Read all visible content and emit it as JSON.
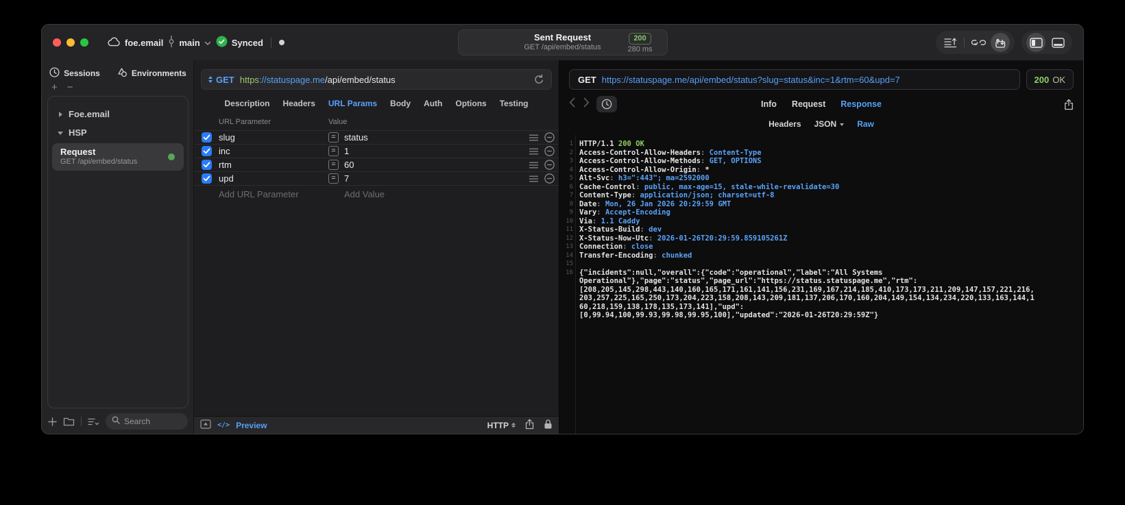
{
  "accent": "#58a0f8",
  "titlebar": {
    "project": "foe.email",
    "branch": "main",
    "sync_label": "Synced",
    "request_card": {
      "title": "Sent Request",
      "subtitle": "GET /api/embed/status",
      "status_code": "200",
      "duration": "280 ms"
    }
  },
  "sidebar": {
    "tabs": [
      {
        "label": "Sessions"
      },
      {
        "label": "Environments"
      }
    ],
    "add_label": "+",
    "remove_label": "−",
    "tree": [
      {
        "label": "Foe.email"
      },
      {
        "label": "HSP"
      }
    ],
    "request_item": {
      "title": "Request",
      "subtitle": "GET /api/embed/status"
    },
    "search_placeholder": "Search"
  },
  "request_panel": {
    "method": "GET",
    "url": {
      "scheme": "https",
      "host": "://statuspage.me",
      "path": "/api/embed/status"
    },
    "tabs": [
      "Description",
      "Headers",
      "URL Params",
      "Body",
      "Auth",
      "Options",
      "Testing"
    ],
    "active_tab": "URL Params",
    "params": {
      "col_name": "URL Parameter",
      "col_value": "Value",
      "rows": [
        {
          "name": "slug",
          "value": "status",
          "checked": true
        },
        {
          "name": "inc",
          "value": "1",
          "checked": true
        },
        {
          "name": "rtm",
          "value": "60",
          "checked": true
        },
        {
          "name": "upd",
          "value": "7",
          "checked": true
        }
      ],
      "add_name": "Add URL Parameter",
      "add_value": "Add Value"
    },
    "footer": {
      "code_glyph": "</>",
      "preview": "Preview",
      "protocol": "HTTP"
    }
  },
  "response_panel": {
    "method": "GET",
    "url": "https://statuspage.me/api/embed/status?slug=status&inc=1&rtm=60&upd=7",
    "status_code": "200",
    "status_text": "OK",
    "tabs": [
      "Info",
      "Request",
      "Response"
    ],
    "active_tab": "Response",
    "subtabs": [
      "Headers",
      "JSON",
      "Raw"
    ],
    "active_subtab": "Raw",
    "code_lines": [
      {
        "n": "1",
        "seg": [
          [
            "HTTP/1.1 ",
            "p"
          ],
          [
            "200 OK",
            "g"
          ]
        ]
      },
      {
        "n": "2",
        "seg": [
          [
            "Access-Control-Allow-Headers",
            "p"
          ],
          [
            ": ",
            "d"
          ],
          [
            "Content-Type",
            "b"
          ]
        ]
      },
      {
        "n": "3",
        "seg": [
          [
            "Access-Control-Allow-Methods",
            "p"
          ],
          [
            ": ",
            "d"
          ],
          [
            "GET, OPTIONS",
            "b"
          ]
        ]
      },
      {
        "n": "4",
        "seg": [
          [
            "Access-Control-Allow-Origin",
            "p"
          ],
          [
            ": ",
            "d"
          ],
          [
            "*",
            "p"
          ]
        ]
      },
      {
        "n": "5",
        "seg": [
          [
            "Alt-Svc",
            "p"
          ],
          [
            ": ",
            "d"
          ],
          [
            "h3=\":443\"; ma=2592000",
            "b"
          ]
        ]
      },
      {
        "n": "6",
        "seg": [
          [
            "Cache-Control",
            "p"
          ],
          [
            ": ",
            "d"
          ],
          [
            "public, max-age=15, stale-while-revalidate=30",
            "b"
          ]
        ]
      },
      {
        "n": "7",
        "seg": [
          [
            "Content-Type",
            "p"
          ],
          [
            ": ",
            "d"
          ],
          [
            "application/json; charset=utf-8",
            "b"
          ]
        ]
      },
      {
        "n": "8",
        "seg": [
          [
            "Date",
            "p"
          ],
          [
            ": ",
            "d"
          ],
          [
            "Mon, 26 Jan 2026 20:29:59 GMT",
            "b"
          ]
        ]
      },
      {
        "n": "9",
        "seg": [
          [
            "Vary",
            "p"
          ],
          [
            ": ",
            "d"
          ],
          [
            "Accept-Encoding",
            "b"
          ]
        ]
      },
      {
        "n": "10",
        "seg": [
          [
            "Via",
            "p"
          ],
          [
            ": ",
            "d"
          ],
          [
            "1.1 Caddy",
            "b"
          ]
        ]
      },
      {
        "n": "11",
        "seg": [
          [
            "X-Status-Build",
            "p"
          ],
          [
            ": ",
            "d"
          ],
          [
            "dev",
            "b"
          ]
        ]
      },
      {
        "n": "12",
        "seg": [
          [
            "X-Status-Now-Utc",
            "p"
          ],
          [
            ": ",
            "d"
          ],
          [
            "2026-01-26T20:29:59.859105261Z",
            "b"
          ]
        ]
      },
      {
        "n": "13",
        "seg": [
          [
            "Connection",
            "p"
          ],
          [
            ": ",
            "d"
          ],
          [
            "close",
            "b"
          ]
        ]
      },
      {
        "n": "14",
        "seg": [
          [
            "Transfer-Encoding",
            "p"
          ],
          [
            ": ",
            "d"
          ],
          [
            "chunked",
            "b"
          ]
        ]
      },
      {
        "n": "15",
        "seg": []
      },
      {
        "n": "16",
        "seg": [
          [
            "{\"incidents\":null,\"overall\":{\"code\":\"operational\",\"label\":\"All Systems",
            "p"
          ]
        ]
      },
      {
        "n": "",
        "seg": [
          [
            "Operational\"},\"page\":\"status\",\"page_url\":\"https://status.statuspage.me\",\"rtm\":",
            "p"
          ]
        ]
      },
      {
        "n": "",
        "seg": [
          [
            "[208,205,145,298,443,140,160,165,171,161,141,156,231,169,167,214,185,410,173,173,211,209,147,157,221,216,",
            "p"
          ]
        ]
      },
      {
        "n": "",
        "seg": [
          [
            "203,257,225,165,250,173,204,223,158,208,143,209,181,137,206,170,160,204,149,154,134,234,220,133,163,144,1",
            "p"
          ]
        ]
      },
      {
        "n": "",
        "seg": [
          [
            "60,218,159,138,178,135,173,141],\"upd\":",
            "p"
          ]
        ]
      },
      {
        "n": "",
        "seg": [
          [
            "[0,99.94,100,99.93,99.98,99.95,100],\"updated\":\"2026-01-26T20:29:59Z\"}",
            "p"
          ]
        ]
      }
    ]
  }
}
